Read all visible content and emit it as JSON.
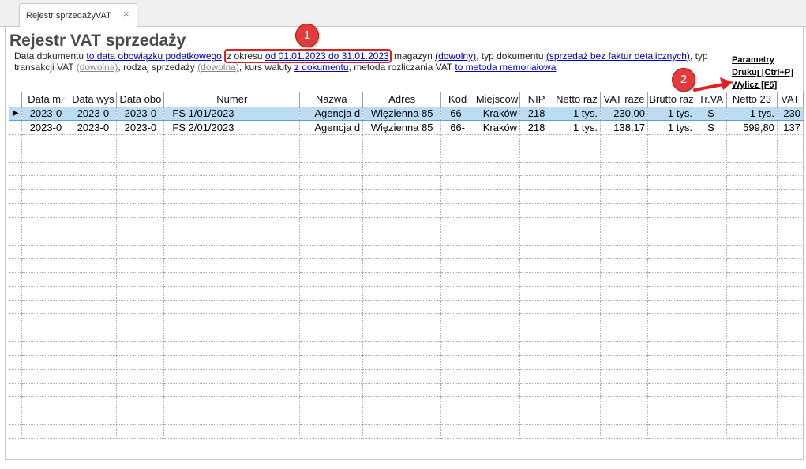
{
  "tab": {
    "label": "Rejestr sprzedażyVAT",
    "close": "×"
  },
  "title": "Rejestr VAT sprzedaży",
  "filters": {
    "t1": "Data dokumentu ",
    "l1": "to data obowiązku podatkowego",
    "t2": ",",
    "t3": "z okresu ",
    "l2": "od 01.01.2023 do 31.01.2023",
    "t4": " magazyn ",
    "l3": "(dowolny)",
    "t5": ", typ dokumentu ",
    "l4": "(sprzedaż bez faktur detalicznych)",
    "t6": ", typ transakcji VAT ",
    "l5": "(dowolna)",
    "t7": ", rodzaj sprzedaży ",
    "l6": "(dowolna)",
    "t8": ", kurs waluty ",
    "l7": "z dokumentu",
    "t9": ", metoda rozliczania VAT ",
    "l8": "to metoda memoriałowa"
  },
  "side_links": {
    "params": "Parametry",
    "print": "Drukuj [Ctrl+P]",
    "calc": "Wylicz [F5]"
  },
  "markers": {
    "m1": "1",
    "m2": "2"
  },
  "colors": {
    "marker": "#e23b3b",
    "selected_row": "#bcdcf4",
    "link": "#0000cc"
  },
  "table": {
    "columns": [
      "Data m",
      "Data wys",
      "Data obo",
      "Numer",
      "Nazwa",
      "Adres",
      "Kod",
      "Miejscow",
      "NIP",
      "Netto raz",
      "VAT raze",
      "Brutto raz",
      "Tr.VA",
      "Netto 23",
      "VAT"
    ],
    "sort_icon": "⁄",
    "rows": [
      {
        "indicator": "▶",
        "cells": [
          "2023-0",
          "2023-0",
          "2023-0",
          "FS 1/01/2023",
          "Agencja d",
          "Więzienna  85",
          "66-",
          "Kraków",
          "218",
          "1 tys.",
          "230,00",
          "1 tys.",
          "S",
          "1 tys.",
          "230"
        ]
      },
      {
        "indicator": "",
        "cells": [
          "2023-0",
          "2023-0",
          "2023-0",
          "FS 2/01/2023",
          "Agencja d",
          "Więzienna  85",
          "66-",
          "Kraków",
          "218",
          "1 tys.",
          "138,17",
          "1 tys.",
          "S",
          "599,80",
          "137"
        ]
      }
    ]
  }
}
